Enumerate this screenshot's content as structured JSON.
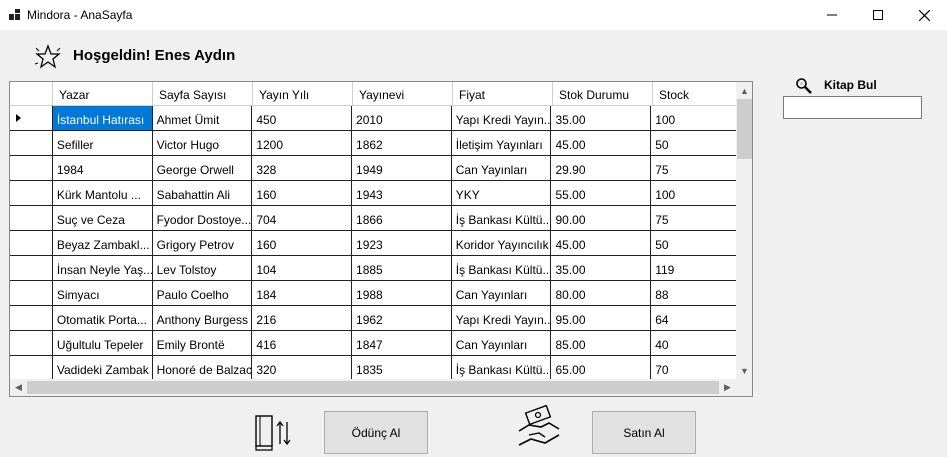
{
  "window": {
    "title": "Mindora - AnaSayfa"
  },
  "welcome": {
    "text": "Hoşgeldin! Enes Aydın"
  },
  "grid": {
    "columns": [
      "Yazar",
      "Sayfa Sayısı",
      "Yayın Yılı",
      "Yayınevi",
      "Fiyat",
      "Stok Durumu",
      "Stock"
    ],
    "rows": [
      [
        "İstanbul Hatırası",
        "Ahmet Ümit",
        "450",
        "2010",
        "Yapı Kredi Yayın...",
        "35.00",
        "100"
      ],
      [
        "Sefiller",
        "Victor Hugo",
        "1200",
        "1862",
        "İletişim Yayınları",
        "45.00",
        "50"
      ],
      [
        "1984",
        "George Orwell",
        "328",
        "1949",
        "Can Yayınları",
        "29.90",
        "75"
      ],
      [
        "Kürk Mantolu ...",
        "Sabahattin Ali",
        "160",
        "1943",
        "YKY",
        "55.00",
        "100"
      ],
      [
        "Suç ve Ceza",
        "Fyodor Dostoye...",
        "704",
        "1866",
        "İş Bankası Kültü...",
        "90.00",
        "75"
      ],
      [
        "Beyaz Zambakl...",
        "Grigory Petrov",
        "160",
        "1923",
        "Koridor Yayıncılık",
        "45.00",
        "50"
      ],
      [
        "İnsan Neyle Yaş...",
        "Lev Tolstoy",
        "104",
        "1885",
        "İş Bankası Kültü...",
        "35.00",
        "119"
      ],
      [
        "Simyacı",
        "Paulo Coelho",
        "184",
        "1988",
        "Can Yayınları",
        "80.00",
        "88"
      ],
      [
        "Otomatik Porta...",
        "Anthony Burgess",
        "216",
        "1962",
        "Yapı Kredi Yayın...",
        "95.00",
        "64"
      ],
      [
        "Uğultulu Tepeler",
        "Emily Brontë",
        "416",
        "1847",
        "Can Yayınları",
        "85.00",
        "40"
      ],
      [
        "Vadideki Zambak",
        "Honoré de Balzac",
        "320",
        "1835",
        "İş Bankası Kültü...",
        "65.00",
        "70"
      ]
    ],
    "selected_row": 0
  },
  "search": {
    "label": "Kitap Bul",
    "value": ""
  },
  "actions": {
    "borrow_label": "Ödünç Al",
    "buy_label": "Satın Al"
  },
  "colors": {
    "selection": "#0078d7",
    "background": "#f0f0f0"
  },
  "icons": {
    "app": "app-logo-icon",
    "welcome": "star-burst-icon",
    "search": "magnifier-icon",
    "borrow": "book-exchange-icon",
    "buy": "handshake-money-icon"
  }
}
